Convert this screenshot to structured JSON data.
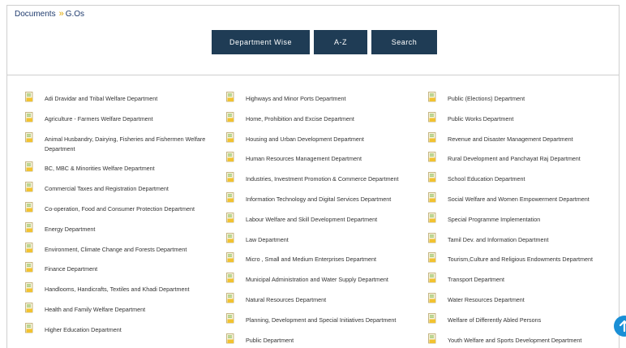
{
  "breadcrumb": {
    "root": "Documents",
    "separator": "»",
    "current": "G.Os"
  },
  "buttons": {
    "department_wise": "Department Wise",
    "az": "A-Z",
    "search": "Search"
  },
  "columns": [
    [
      "Adi Dravidar and Tribal Welfare Department",
      "Agriculture - Farmers Welfare Department",
      "Animal Husbandry, Dairying, Fisheries and Fishermen Welfare Department",
      "BC, MBC & Minorities Welfare Department",
      "Commercial Taxes and Registration Department",
      "Co-operation, Food and Consumer Protection Department",
      "Energy Department",
      "Environment, Climate Change and Forests Department",
      "Finance Department",
      "Handlooms, Handicrafts, Textiles and Khadi Department",
      "Health and Family Welfare Department",
      "Higher Education Department"
    ],
    [
      "Highways and Minor Ports Department",
      "Home, Prohibition and Excise Department",
      "Housing and Urban Development Department",
      "Human Resources Management Department",
      "Industries, Investment Promotion & Commerce Department",
      "Information Technology and Digital Services Department",
      "Labour Welfare and Skill Development Department",
      "Law Department",
      "Micro , Small and Medium Enterprises Department",
      "Municipal Administration and Water Supply Department",
      "Natural Resources Department",
      "Planning, Development and Special Initiatives Department",
      "Public Department"
    ],
    [
      "Public (Elections) Department",
      "Public Works Department",
      "Revenue and Disaster Management Department",
      "Rural Development and Panchayat Raj Department",
      "School Education Department",
      "Social Welfare and Women Empowerment Department",
      "Special Programme Implementation",
      "Tamil Dev. and Information Department",
      "Tourism,Culture and Religious Endowments Department",
      "Transport Department",
      "Water Resources Department",
      "Welfare of Differently Abled Persons",
      "Youth Welfare and Sports Development Department"
    ]
  ],
  "icons": {
    "department": "document-icon",
    "scroll": "arrow-up-icon"
  },
  "colors": {
    "button_bg": "#1f3c55",
    "scroll_btn": "#1a8fd6",
    "icon_yellow": "#f2c230",
    "icon_green": "#7cb342"
  }
}
